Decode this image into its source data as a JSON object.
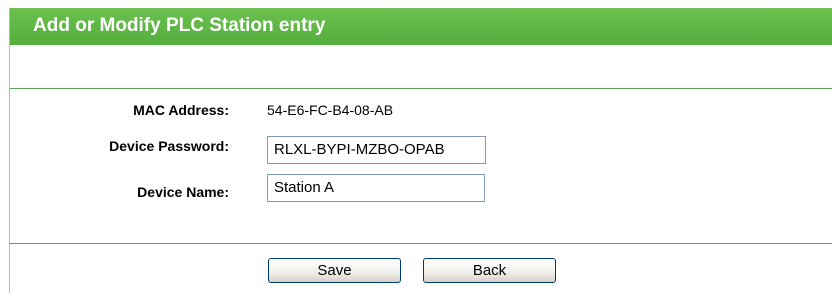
{
  "header": {
    "title": "Add or Modify PLC Station entry"
  },
  "form": {
    "mac": {
      "label": "MAC Address:",
      "value": "54-E6-FC-B4-08-AB"
    },
    "password": {
      "label": "Device Password:",
      "value": "RLXL-BYPI-MZBO-OPAB"
    },
    "name": {
      "label": "Device Name:",
      "value": "Station A"
    }
  },
  "buttons": {
    "save_label": "Save",
    "back_label": "Back"
  },
  "colors": {
    "accent": "#5cb85c",
    "divider": "#5aa55a"
  }
}
